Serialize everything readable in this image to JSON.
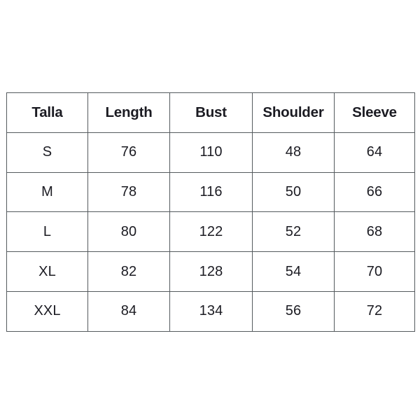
{
  "table": {
    "caption": "",
    "columns": [
      "Talla",
      "Length",
      "Bust",
      "Shoulder",
      "Sleeve"
    ],
    "rows": [
      {
        "cells": [
          "S",
          "76",
          "110",
          "48",
          "64"
        ]
      },
      {
        "cells": [
          "M",
          "78",
          "116",
          "50",
          "66"
        ]
      },
      {
        "cells": [
          "L",
          "80",
          "122",
          "52",
          "68"
        ]
      },
      {
        "cells": [
          "XL",
          "82",
          "128",
          "54",
          "70"
        ]
      },
      {
        "cells": [
          "XXL",
          "84",
          "134",
          "56",
          "72"
        ]
      }
    ]
  },
  "colors": {
    "background": "#ffffff",
    "border": "#555a5e",
    "text": "#1b1b22"
  }
}
